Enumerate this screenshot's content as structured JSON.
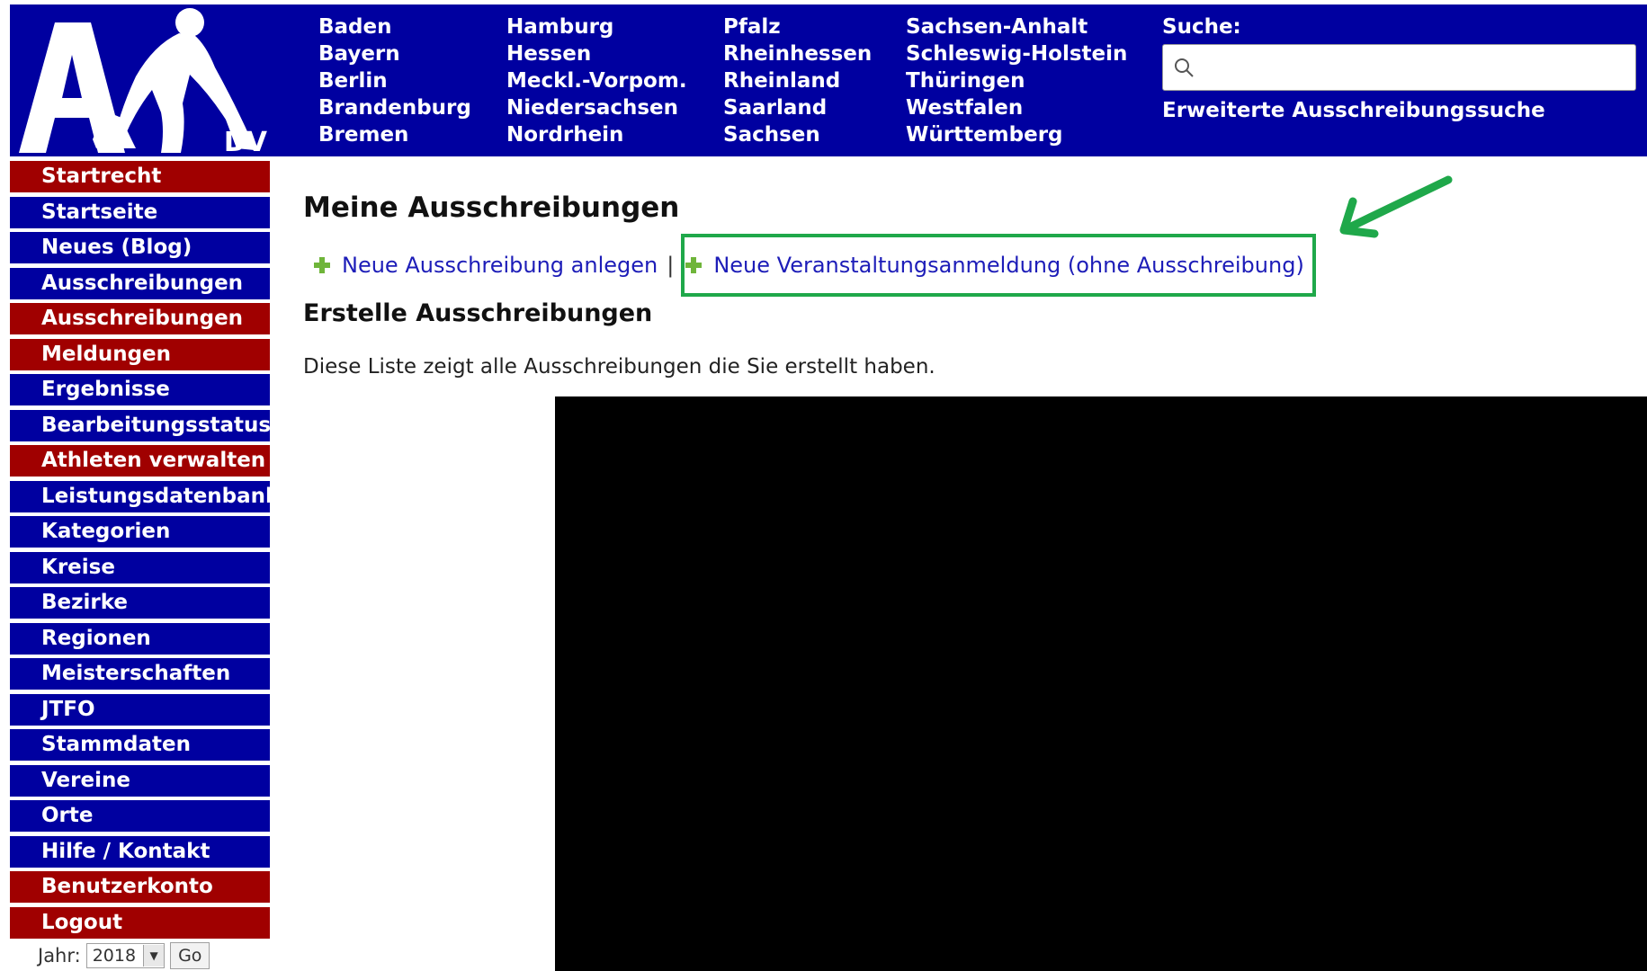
{
  "logo": {
    "text": "DV"
  },
  "regions": {
    "col1": [
      "Baden",
      "Bayern",
      "Berlin",
      "Brandenburg",
      "Bremen"
    ],
    "col2": [
      "Hamburg",
      "Hessen",
      "Meckl.-Vorpom.",
      "Niedersachsen",
      "Nordrhein"
    ],
    "col3": [
      "Pfalz",
      "Rheinhessen",
      "Rheinland",
      "Saarland",
      "Sachsen"
    ],
    "col4": [
      "Sachsen-Anhalt",
      "Schleswig-Holstein",
      "Thüringen",
      "Westfalen",
      "Württemberg"
    ]
  },
  "search": {
    "title": "Suche:",
    "placeholder": "",
    "advanced_link": "Erweiterte Ausschreibungssuche"
  },
  "sidebar": {
    "items": [
      {
        "label": "Startrecht",
        "color": "#a00000"
      },
      {
        "label": "Startseite",
        "color": "#0000a0"
      },
      {
        "label": "Neues (Blog)",
        "color": "#0000a0"
      },
      {
        "label": "Ausschreibungen",
        "color": "#0000a0"
      },
      {
        "label": "Ausschreibungen",
        "color": "#a00000"
      },
      {
        "label": "Meldungen",
        "color": "#a00000"
      },
      {
        "label": "Ergebnisse",
        "color": "#0000a0"
      },
      {
        "label": "Bearbeitungsstatus",
        "color": "#0000a0"
      },
      {
        "label": "Athleten verwalten",
        "color": "#a00000"
      },
      {
        "label": "Leistungsdatenbank",
        "color": "#0000a0"
      },
      {
        "label": "Kategorien",
        "color": "#0000a0"
      },
      {
        "label": "Kreise",
        "color": "#0000a0"
      },
      {
        "label": "Bezirke",
        "color": "#0000a0"
      },
      {
        "label": "Regionen",
        "color": "#0000a0"
      },
      {
        "label": "Meisterschaften",
        "color": "#0000a0"
      },
      {
        "label": "JTFO",
        "color": "#0000a0"
      },
      {
        "label": "Stammdaten",
        "color": "#0000a0"
      },
      {
        "label": "Vereine",
        "color": "#0000a0"
      },
      {
        "label": "Orte",
        "color": "#0000a0"
      },
      {
        "label": "Hilfe / Kontakt",
        "color": "#0000a0"
      },
      {
        "label": "Benutzerkonto",
        "color": "#a00000"
      },
      {
        "label": "Logout",
        "color": "#a00000"
      }
    ],
    "year_label": "Jahr:",
    "year_value": "2018",
    "go_label": "Go"
  },
  "main": {
    "title": "Meine Ausschreibungen",
    "new_tender_link": "Neue Ausschreibung anlegen",
    "separator": "|",
    "new_event_link": "Neue Veranstaltungsanmeldung (ohne Ausschreibung)",
    "section_title": "Erstelle Ausschreibungen",
    "description": "Diese Liste zeigt alle Ausschreibungen die Sie erstellt haben."
  },
  "colors": {
    "header_blue": "#0000a0",
    "nav_red": "#a00000",
    "link_blue": "#1d1db8",
    "highlight_green": "#1fa84a"
  }
}
